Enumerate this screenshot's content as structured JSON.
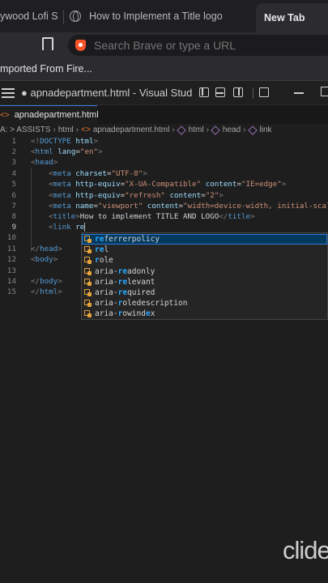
{
  "browser": {
    "tabs": [
      {
        "label": "ywood Lofi S"
      },
      {
        "label": "How to Implement a Title logo"
      },
      {
        "label": "New Tab"
      }
    ],
    "address_placeholder": "Search Brave or type a URL",
    "bookmark_item": "mported From Fire..."
  },
  "vscode": {
    "title": "● apnadepartment.html - Visual Studi...",
    "tab": {
      "label": "apnadepartment.html"
    },
    "breadcrumb": [
      "A: > ASSISTS",
      "html",
      "apnadepartment.html",
      "html",
      "head",
      "link"
    ],
    "line_numbers": [
      "1",
      "2",
      "3",
      "4",
      "5",
      "6",
      "7",
      "8",
      "9",
      "10",
      "11",
      "12",
      "13",
      "14",
      "15"
    ],
    "suggestions": [
      {
        "pre": "",
        "hl": "re",
        "post": "ferrerpolicy"
      },
      {
        "pre": "",
        "hl": "re",
        "post": "l"
      },
      {
        "pre": "",
        "hl": "r",
        "post": "ole"
      },
      {
        "pre": "aria-",
        "hl": "re",
        "post": "adonly"
      },
      {
        "pre": "aria-",
        "hl": "re",
        "post": "levant"
      },
      {
        "pre": "aria-",
        "hl": "re",
        "post": "quired"
      },
      {
        "pre": "aria-",
        "hl": "r",
        "post": "oledescription"
      },
      {
        "pre": "aria-",
        "hl": "r",
        "post": "owind",
        "hl2": "e",
        "post2": "x"
      }
    ]
  },
  "watermark": "clide"
}
